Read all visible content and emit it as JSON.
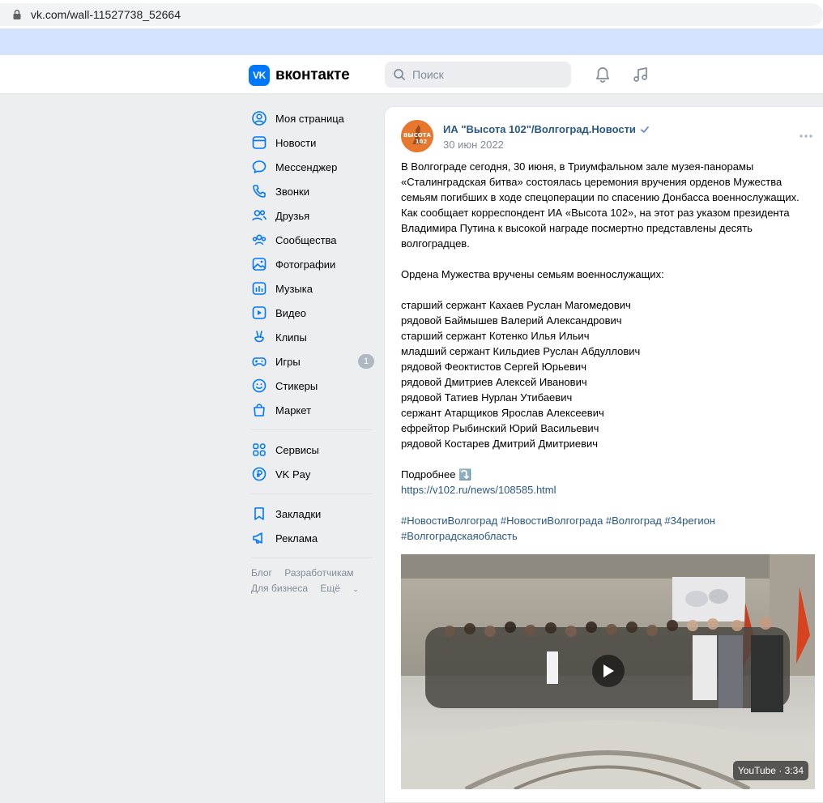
{
  "browser": {
    "url": "vk.com/wall-11527738_52664"
  },
  "header": {
    "logo_mark": "VK",
    "logo_word": "вконтакте",
    "search_placeholder": "Поиск"
  },
  "sidebar": {
    "items": [
      {
        "label": "Моя страница",
        "icon": "user-icon"
      },
      {
        "label": "Новости",
        "icon": "news-icon"
      },
      {
        "label": "Мессенджер",
        "icon": "message-icon"
      },
      {
        "label": "Звонки",
        "icon": "phone-icon"
      },
      {
        "label": "Друзья",
        "icon": "friends-icon"
      },
      {
        "label": "Сообщества",
        "icon": "communities-icon"
      },
      {
        "label": "Фотографии",
        "icon": "photo-icon"
      },
      {
        "label": "Музыка",
        "icon": "music-icon"
      },
      {
        "label": "Видео",
        "icon": "video-icon"
      },
      {
        "label": "Клипы",
        "icon": "clips-icon"
      },
      {
        "label": "Игры",
        "icon": "games-icon",
        "count": "1"
      },
      {
        "label": "Стикеры",
        "icon": "stickers-icon"
      },
      {
        "label": "Маркет",
        "icon": "market-icon"
      }
    ],
    "items2": [
      {
        "label": "Сервисы",
        "icon": "services-icon"
      },
      {
        "label": "VK Pay",
        "icon": "vkpay-icon"
      }
    ],
    "items3": [
      {
        "label": "Закладки",
        "icon": "bookmark-icon"
      },
      {
        "label": "Реклама",
        "icon": "ads-icon"
      }
    ],
    "footer": {
      "blog": "Блог",
      "developers": "Разработчикам",
      "business": "Для бизнеса",
      "more": "Ещё"
    }
  },
  "post": {
    "author": "ИА \"Высота 102\"/Волгоград.Новости",
    "avatar_text": "ВЫСОТА 102",
    "date": "30 июн 2022",
    "lines": [
      "В Волгограде сегодня, 30 июня, в Триумфальном зале музея-панорамы",
      "«Сталинградская битва» состоялась церемония вручения орденов Мужества",
      "семьям погибших в ходе спецоперации по спасению Донбасса военнослужащих.",
      "Как сообщает корреспондент ИА «Высота 102», на этот раз указом президента",
      "Владимира Путина к высокой награде посмертно представлены десять",
      "волгоградцев.",
      "",
      "Ордена Мужества вручены семьям военнослужащих:",
      "",
      "старший сержант Кахаев Руслан Магомедович",
      "рядовой Баймышев Валерий Александрович",
      "старший сержант Котенко Илья Ильич",
      "младший сержант Кильдиев Руслан Абдуллович",
      "рядовой Феоктистов Сергей Юрьевич",
      "рядовой Дмитриев Алексей Иванович",
      "рядовой Татиев Нурлан Утибаевич",
      "сержант Атарщиков Ярослав Алексеевич",
      "ефрейтор Рыбинский Юрий Васильевич",
      "рядовой Костарев Дмитрий Дмитриевич",
      "",
      "Подробнее ⤵️"
    ],
    "link": "https://v102.ru/news/108585.html",
    "hashtags_line1": "#НовостиВолгоград #НовостиВолгограда #Волгоград #34регион",
    "hashtags_line2": "#Волгоградскаяобласть",
    "video_badge": "YouTube · 3:34"
  },
  "colors": {
    "accent": "#0077ff",
    "link": "#2a5885",
    "secondary_text": "#818c99",
    "page_bg": "#edeef0"
  }
}
